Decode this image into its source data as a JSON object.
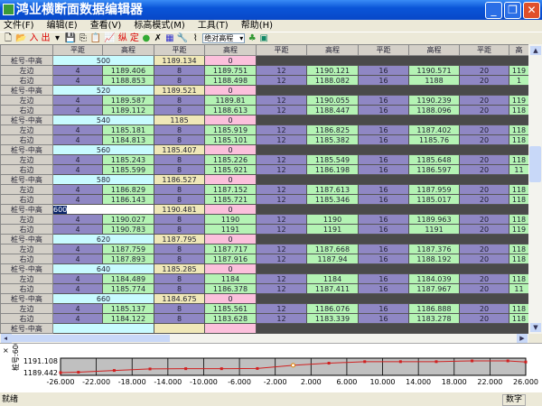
{
  "window": {
    "title": "鸿业横断面数据编辑器"
  },
  "menu": [
    "文件(F)",
    "编辑(E)",
    "查看(V)",
    "标高模式(M)",
    "工具(T)",
    "帮助(H)"
  ],
  "toolbar": {
    "in_label": "入",
    "out_label": "出",
    "zong_label": "纵",
    "ding_label": "定",
    "mode_select": "绝对高程"
  },
  "grid": {
    "headers": [
      "平距",
      "高程",
      "平距",
      "高程",
      "平距",
      "高程",
      "平距",
      "高程",
      "平距",
      "高"
    ],
    "row_labels": {
      "station": "桩号-中高",
      "left": "左边",
      "right": "右边"
    },
    "offsets": [
      "4",
      "8",
      "12",
      "16",
      "20"
    ],
    "zero": "0",
    "editing_station": "600",
    "groups": [
      {
        "station": "500",
        "center": "1189.134",
        "left": [
          "1189.406",
          "1189.751",
          "1190.121",
          "1190.571"
        ],
        "right": [
          "1188.853",
          "1188.498",
          "1188.082",
          "1188"
        ],
        "lp": "119",
        "rp": "1"
      },
      {
        "station": "520",
        "center": "1189.521",
        "left": [
          "1189.587",
          "1189.81",
          "1190.055",
          "1190.239"
        ],
        "right": [
          "1189.112",
          "1188.613",
          "1188.447",
          "1188.096"
        ],
        "lp": "119",
        "rp": "118"
      },
      {
        "station": "540",
        "center": "1185",
        "left": [
          "1185.181",
          "1185.919",
          "1186.825",
          "1187.402"
        ],
        "right": [
          "1184.813",
          "1185.101",
          "1185.382",
          "1185.76"
        ],
        "lp": "118",
        "rp": "118"
      },
      {
        "station": "560",
        "center": "1185.407",
        "left": [
          "1185.243",
          "1185.226",
          "1185.549",
          "1185.648"
        ],
        "right": [
          "1185.599",
          "1185.921",
          "1186.198",
          "1186.597"
        ],
        "lp": "118",
        "rp": "11"
      },
      {
        "station": "580",
        "center": "1186.527",
        "left": [
          "1186.829",
          "1187.152",
          "1187.613",
          "1187.959"
        ],
        "right": [
          "1186.143",
          "1185.721",
          "1185.346",
          "1185.017"
        ],
        "lp": "118",
        "rp": "118"
      },
      {
        "station": "600",
        "center": "1190.481",
        "left": [
          "1190.027",
          "1190",
          "1190",
          "1189.963"
        ],
        "right": [
          "1190.783",
          "1191",
          "1191",
          "1191"
        ],
        "lp": "118",
        "rp": "119"
      },
      {
        "station": "620",
        "center": "1187.795",
        "left": [
          "1187.759",
          "1187.717",
          "1187.668",
          "1187.376"
        ],
        "right": [
          "1187.893",
          "1187.916",
          "1187.94",
          "1188.192"
        ],
        "lp": "118",
        "rp": "118"
      },
      {
        "station": "640",
        "center": "1185.285",
        "left": [
          "1184.489",
          "1184",
          "1184",
          "1184.039"
        ],
        "right": [
          "1185.774",
          "1186.378",
          "1187.411",
          "1187.967"
        ],
        "lp": "118",
        "rp": "11"
      },
      {
        "station": "660",
        "center": "1184.675",
        "left": [
          "1185.137",
          "1185.561",
          "1186.076",
          "1186.888"
        ],
        "right": [
          "1184.122",
          "1183.628",
          "1183.339",
          "1183.278"
        ],
        "lp": "118",
        "rp": "118"
      }
    ]
  },
  "chart_data": {
    "type": "line",
    "ylabel": "桩号:600",
    "yticks": [
      "1191.108",
      "1189.442"
    ],
    "ylim": [
      1189.442,
      1191.108
    ],
    "xlim": [
      -26,
      26
    ],
    "xticks": [
      "-26.000",
      "-22.000",
      "-18.000",
      "-14.000",
      "-10.000",
      "-6.000",
      "-2.000",
      "2.000",
      "6.000",
      "10.000",
      "14.000",
      "18.000",
      "22.000",
      "26.000"
    ],
    "x": [
      -26,
      -24,
      -20,
      -16,
      -12,
      -8,
      -4,
      0,
      4,
      8,
      12,
      16,
      20,
      24,
      26
    ],
    "y": [
      1189.442,
      1189.5,
      1189.75,
      1189.963,
      1190,
      1190,
      1190.027,
      1190.481,
      1190.783,
      1191,
      1191,
      1191,
      1191.108,
      1191.108,
      1190.95
    ],
    "highlight_index": 7,
    "line_color": "#d02020"
  },
  "status": {
    "ready": "就绪",
    "num": "数字"
  }
}
